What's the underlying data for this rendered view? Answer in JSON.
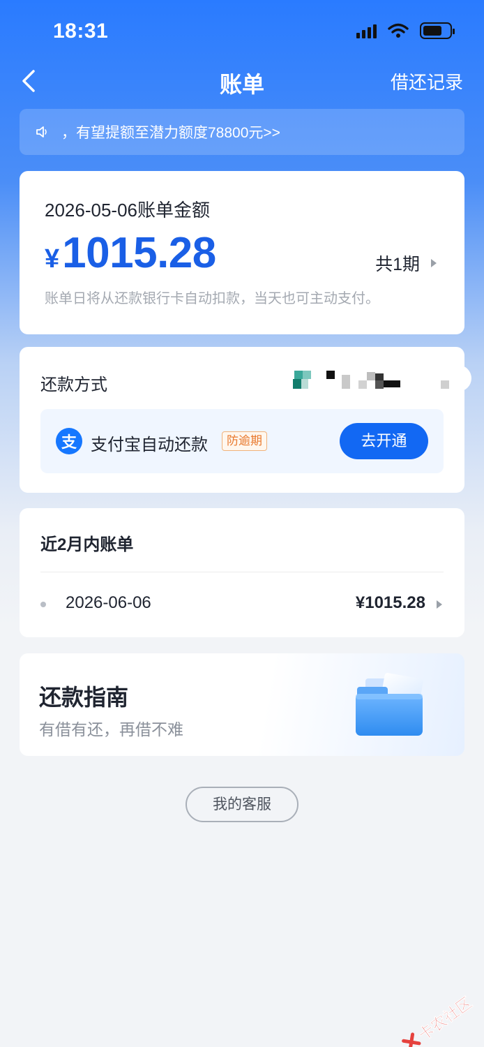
{
  "status_bar": {
    "time": "18:31"
  },
  "nav": {
    "title": "账单",
    "right_label": "借还记录"
  },
  "notice": {
    "text": "，有望提额至潜力额度78800元>>"
  },
  "bill": {
    "date_label": "2026-05-06账单金额",
    "currency": "¥",
    "amount": "1015.28",
    "periods": "共1期",
    "hint": "账单日将从还款银行卡自动扣款，当天也可主动支付。"
  },
  "repay_method": {
    "title": "还款方式",
    "alipay_icon_char": "支",
    "alipay_label": "支付宝自动还款",
    "badge": "防逾期",
    "open_button": "去开通"
  },
  "recent_bills": {
    "title": "近2月内账单",
    "items": [
      {
        "date": "2026-06-06",
        "amount": "¥1015.28"
      }
    ]
  },
  "guide": {
    "title": "还款指南",
    "subtitle": "有借有还，再借不难"
  },
  "service_button": "我的客服",
  "watermark": {
    "text": "卡农社区"
  },
  "colors": {
    "primary": "#1268f3",
    "amount": "#1a5fe6",
    "badge": "#e8782c"
  }
}
